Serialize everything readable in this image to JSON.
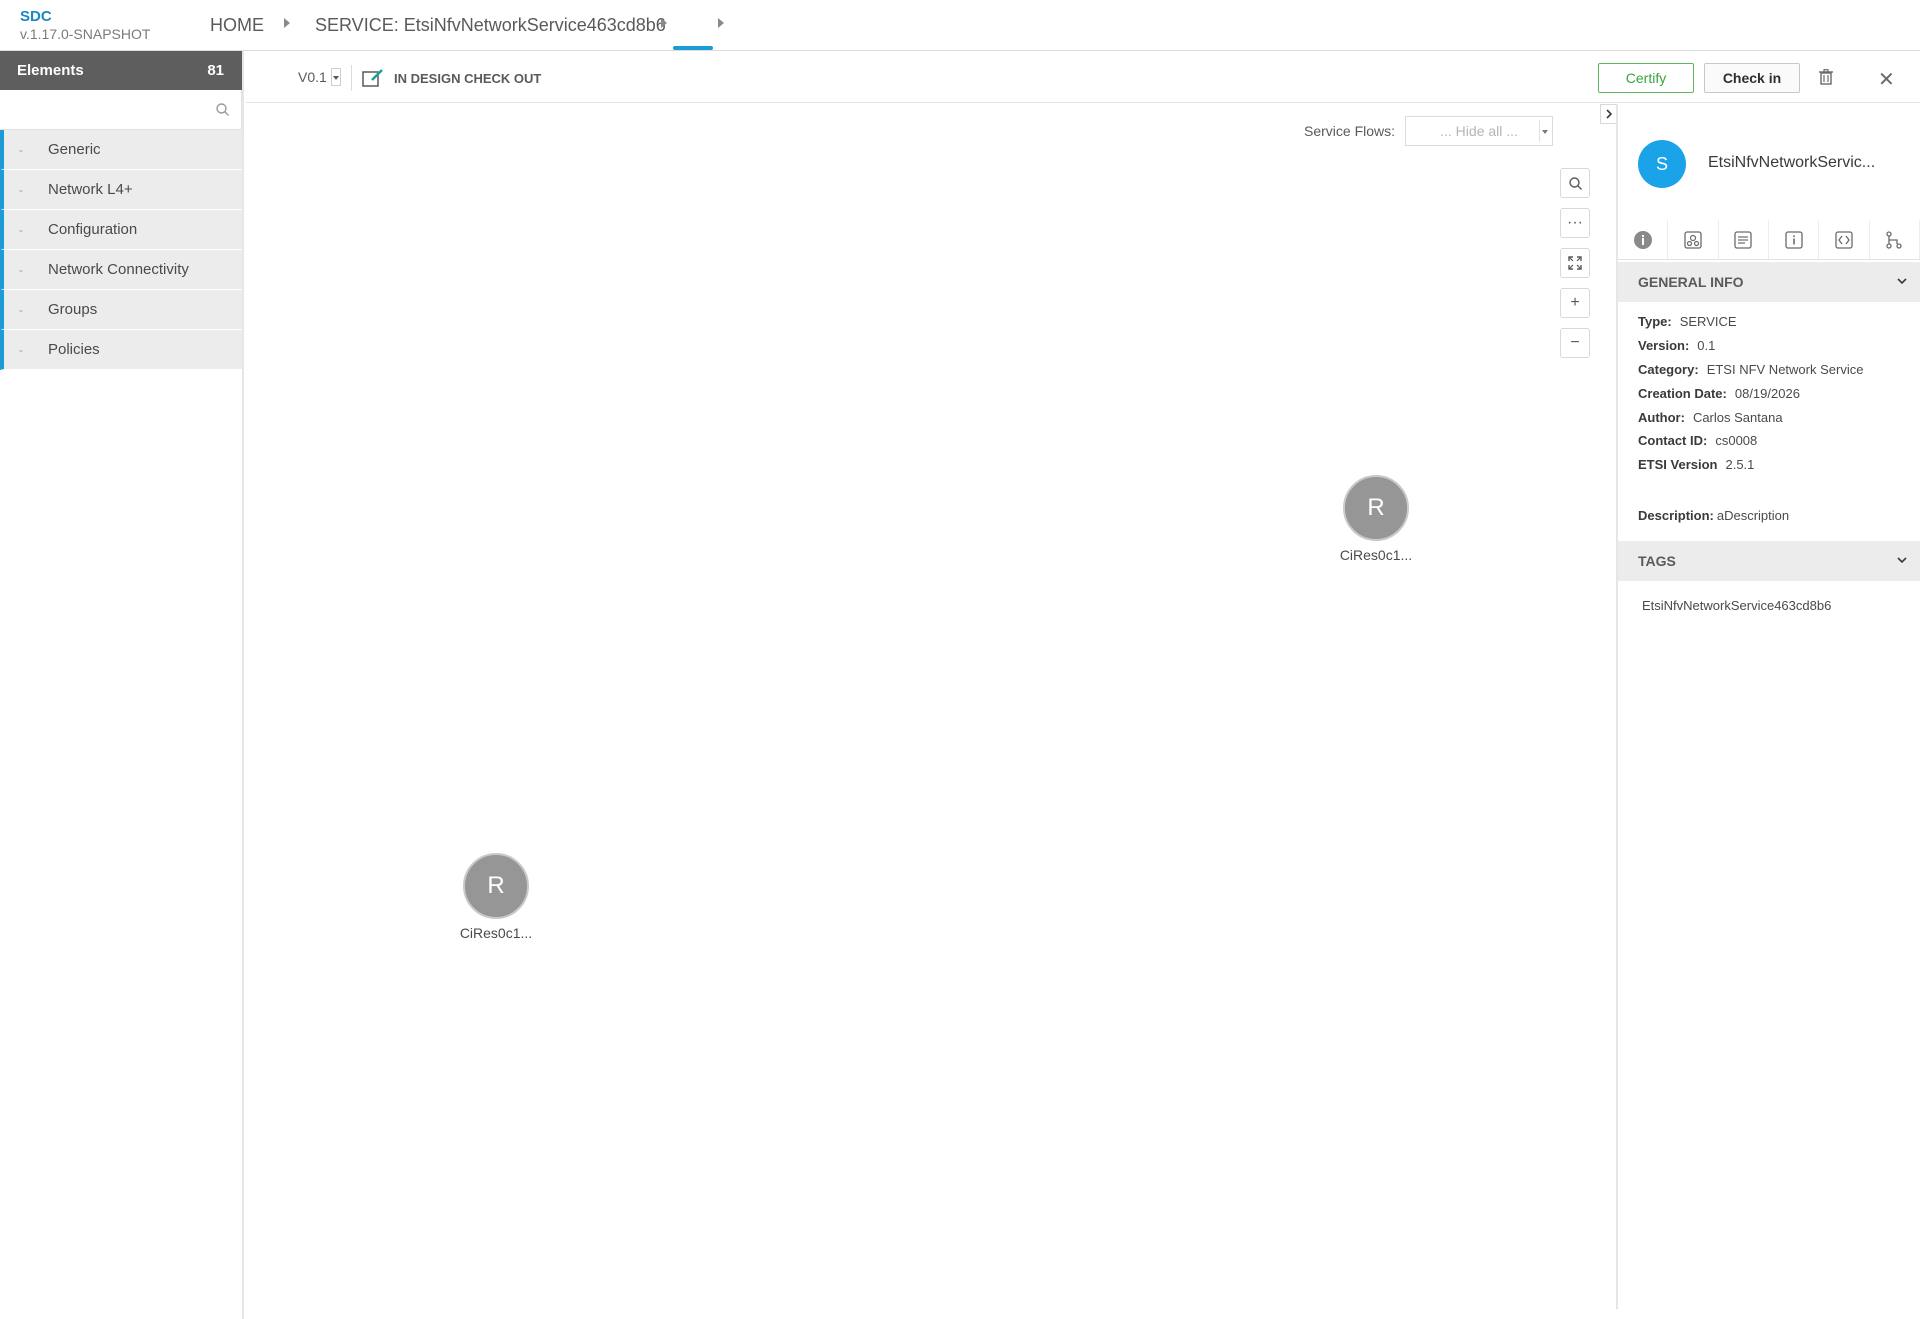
{
  "app": {
    "brand": "SDC",
    "version": "v.1.17.0-SNAPSHOT"
  },
  "breadcrumb": {
    "home": "HOME",
    "service": "SERVICE: EtsiNfvNetworkService463cd8b6"
  },
  "palette": {
    "title": "Elements",
    "count": "81",
    "search_placeholder": "",
    "categories": [
      "Generic",
      "Network L4+",
      "Configuration",
      "Network Connectivity",
      "Groups",
      "Policies"
    ]
  },
  "toolbar": {
    "version": "V0.1",
    "status": "IN DESIGN CHECK OUT",
    "certify": "Certify",
    "checkin": "Check in",
    "close": "✕"
  },
  "canvas": {
    "service_flows_label": "Service Flows:",
    "service_flows_value": "... Hide all ...",
    "zoom_more": "···",
    "zoom_in": "+",
    "zoom_out": "−",
    "nodes": [
      {
        "letter": "R",
        "label": "CiRes0c1..."
      },
      {
        "letter": "R",
        "label": "CiRes0c1..."
      }
    ]
  },
  "panel": {
    "avatar": "S",
    "title": "EtsiNfvNetworkServic...",
    "general_info": "GENERAL INFO",
    "fields": [
      {
        "label": "Type:",
        "value": "SERVICE"
      },
      {
        "label": "Version:",
        "value": "0.1"
      },
      {
        "label": "Category:",
        "value": "ETSI NFV Network Service"
      },
      {
        "label": "Creation Date:",
        "value": "08/19/2026"
      },
      {
        "label": "Author:",
        "value": "Carlos Santana"
      },
      {
        "label": "Contact ID:",
        "value": "cs0008"
      },
      {
        "label": "ETSI Version",
        "value": "2.5.1"
      }
    ],
    "description_label": "Description:",
    "description_value": "aDescription",
    "tags_header": "TAGS",
    "tags": [
      "EtsiNfvNetworkService463cd8b6"
    ]
  },
  "colors": {
    "accent": "#1d9bd6",
    "certify": "#3aa43a",
    "avatar": "#1aa3e8",
    "node": "#969696"
  }
}
